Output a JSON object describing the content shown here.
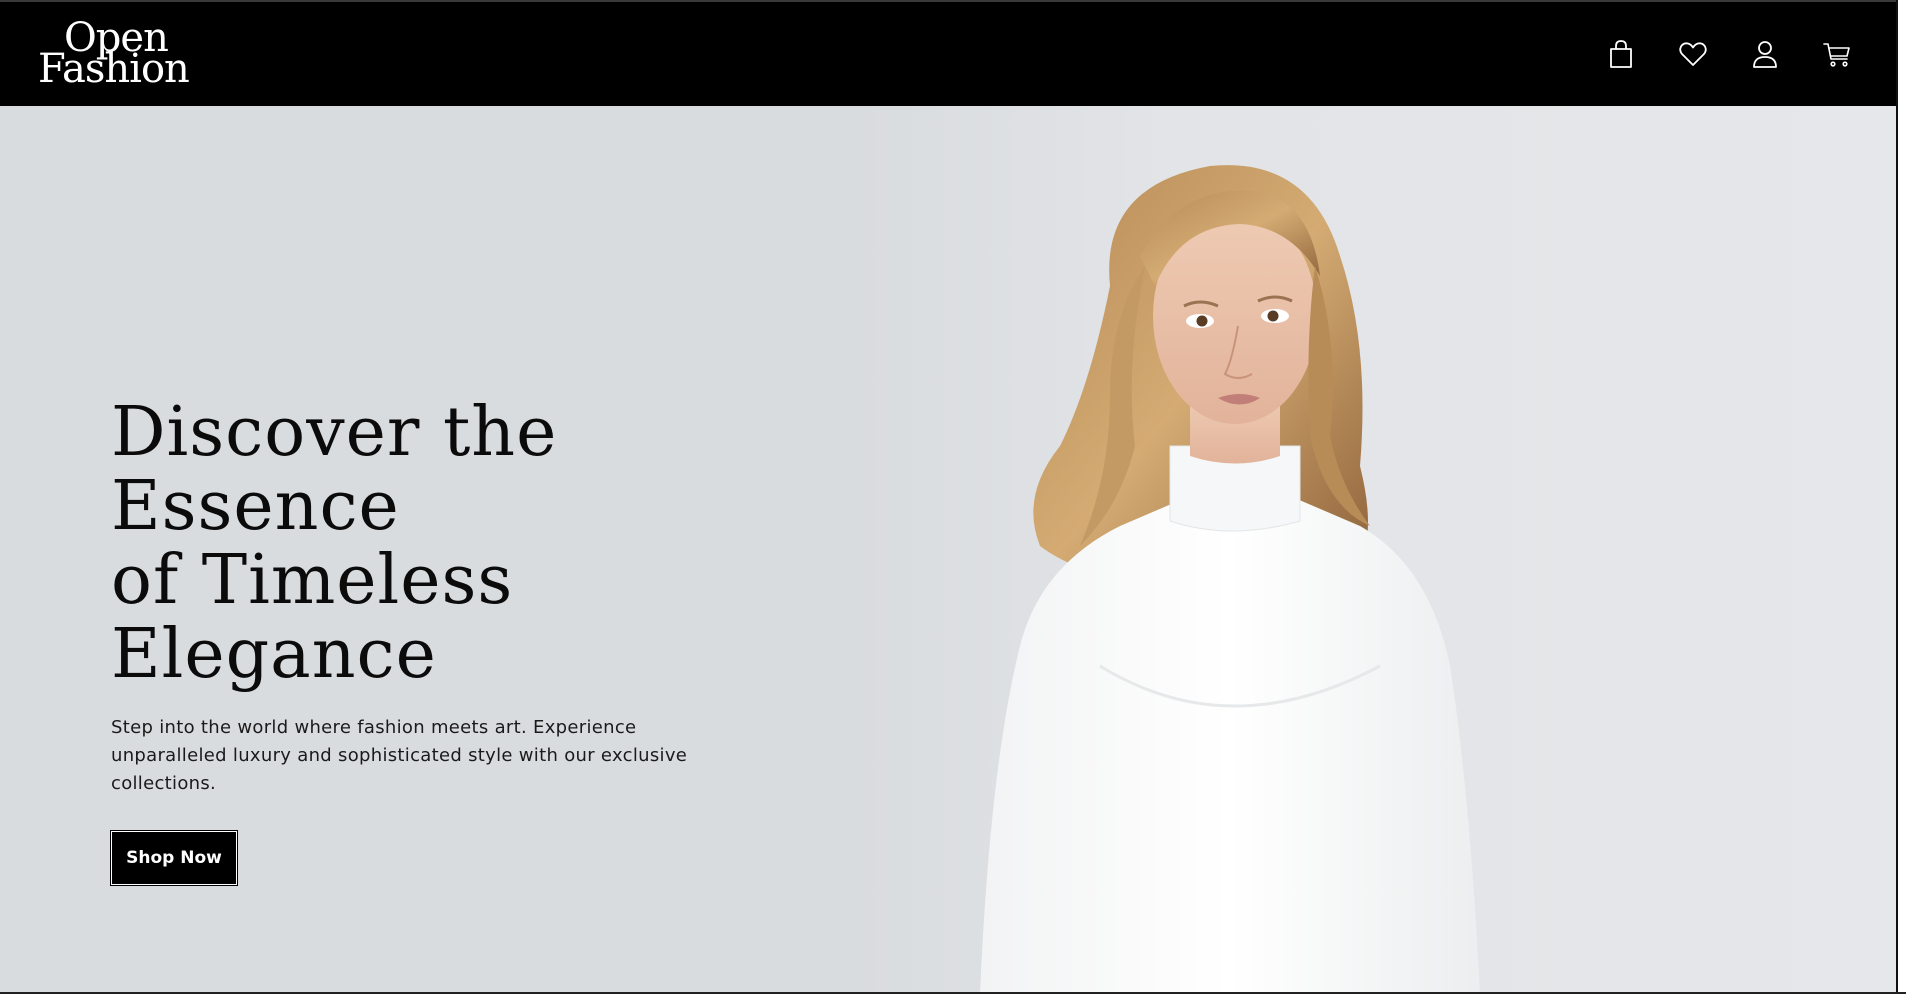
{
  "header": {
    "logo": {
      "line1": "Open",
      "line2": "Fashion"
    },
    "icons": [
      {
        "name": "shopping-bag-icon"
      },
      {
        "name": "heart-icon"
      },
      {
        "name": "user-icon"
      },
      {
        "name": "cart-icon"
      }
    ]
  },
  "hero": {
    "title_line1": "Discover the Essence",
    "title_line2": "of Timeless Elegance",
    "subtitle": "Step into the world where fashion meets art. Experience unparalleled luxury and sophisticated style with our exclusive collections.",
    "cta_label": "Shop Now"
  },
  "colors": {
    "header_bg": "#000000",
    "hero_bg": "#d9dcdf",
    "text": "#0b0b0b",
    "button_bg": "#000000",
    "button_text": "#ffffff"
  }
}
